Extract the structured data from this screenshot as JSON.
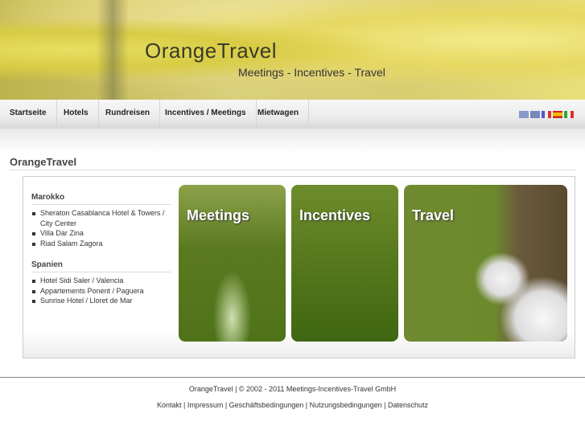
{
  "header": {
    "logo": "OrangeTravel",
    "tagline": "Meetings - Incentives - Travel"
  },
  "nav": [
    "Startseite",
    "Hotels",
    "Rundreisen",
    "Incentives / Meetings",
    "Mietwagen"
  ],
  "languages": [
    {
      "name": "us-flag-icon",
      "color": "#8899cc"
    },
    {
      "name": "uk-flag-icon",
      "color": "#7788bb"
    },
    {
      "name": "fr-flag-icon",
      "color": "#dde"
    },
    {
      "name": "es-flag-icon",
      "color": "#e0a020"
    },
    {
      "name": "it-flag-icon",
      "color": "#4a4"
    }
  ],
  "page_title": "OrangeTravel",
  "sections": [
    {
      "title": "Marokko",
      "items": [
        "Sheraton Casablanca Hotel & Towers / City Center",
        "Villa Dar Zina",
        "Riad Salam Zagora"
      ]
    },
    {
      "title": "Spanien",
      "items": [
        "Hotel Sidi Saler / Valencia",
        "Appartements Ponent / Paguera",
        "Sunrise Hotel / Lloret de Mar"
      ]
    }
  ],
  "tiles": [
    "Meetings",
    "Incentives",
    "Travel"
  ],
  "footer": {
    "copyright": "OrangeTravel | © 2002 - 2011 Meetings-Incentives-Travel GmbH",
    "links": [
      "Kontakt",
      "Impressum",
      "Geschäftsbedingungen",
      "Nutzungsbedingungen",
      "Datenschutz"
    ],
    "sep": " | "
  }
}
